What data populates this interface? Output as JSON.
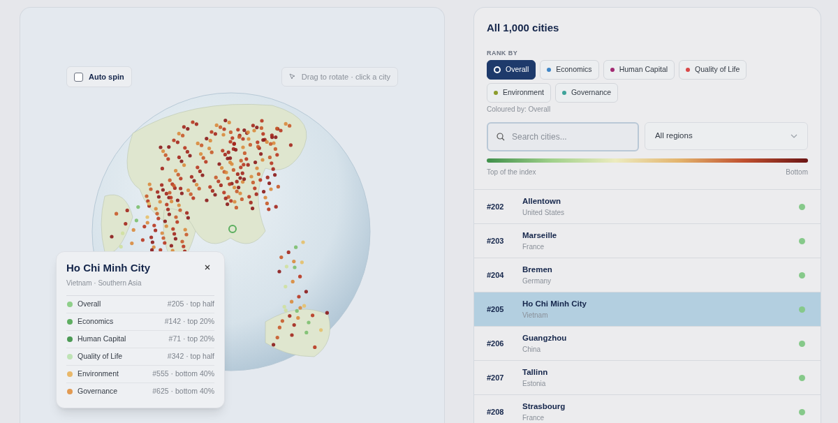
{
  "globe_view": {
    "auto_spin": {
      "label": "Auto spin",
      "checked": false
    },
    "hint": "Drag to rotate · click a city"
  },
  "city_card": {
    "title": "Ho Chi Minh City",
    "subtitle": "Vietnam · Southern Asia",
    "metrics": [
      {
        "label": "Overall",
        "value": "#205 · top half",
        "color": "#8fcf8a"
      },
      {
        "label": "Economics",
        "value": "#142 · top 20%",
        "color": "#5fae62"
      },
      {
        "label": "Human Capital",
        "value": "#71 · top 20%",
        "color": "#4c9a55"
      },
      {
        "label": "Quality of Life",
        "value": "#342 · top half",
        "color": "#bfe3b5"
      },
      {
        "label": "Environment",
        "value": "#555 · bottom 40%",
        "color": "#e9b86a"
      },
      {
        "label": "Governance",
        "value": "#625 · bottom 40%",
        "color": "#e29a52"
      }
    ]
  },
  "city_list": {
    "title": "All 1,000 cities",
    "rank_by_label": "RANK BY",
    "rank_options": [
      {
        "label": "Overall",
        "color": "#ffffff",
        "selected": true
      },
      {
        "label": "Economics",
        "color": "#3f86c6",
        "selected": false
      },
      {
        "label": "Human Capital",
        "color": "#a22a72",
        "selected": false
      },
      {
        "label": "Quality of Life",
        "color": "#d94848",
        "selected": false
      },
      {
        "label": "Environment",
        "color": "#8c9c2c",
        "selected": false
      },
      {
        "label": "Governance",
        "color": "#3fa39a",
        "selected": false
      }
    ],
    "coloured_by": "Coloured by: Overall",
    "search": {
      "placeholder": "Search cities..."
    },
    "region_select": {
      "value": "All regions"
    },
    "legend": {
      "start": "Top of the index",
      "end": "Bottom"
    },
    "cities": [
      {
        "rank": "#202",
        "name": "Allentown",
        "country": "United States",
        "color": "#86c98a",
        "selected": false
      },
      {
        "rank": "#203",
        "name": "Marseille",
        "country": "France",
        "color": "#86c98a",
        "selected": false
      },
      {
        "rank": "#204",
        "name": "Bremen",
        "country": "Germany",
        "color": "#86c98a",
        "selected": false
      },
      {
        "rank": "#205",
        "name": "Ho Chi Minh City",
        "country": "Vietnam",
        "color": "#86c98a",
        "selected": true
      },
      {
        "rank": "#206",
        "name": "Guangzhou",
        "country": "China",
        "color": "#86c98a",
        "selected": false
      },
      {
        "rank": "#207",
        "name": "Tallinn",
        "country": "Estonia",
        "color": "#86c98a",
        "selected": false
      },
      {
        "rank": "#208",
        "name": "Strasbourg",
        "country": "France",
        "color": "#86c98a",
        "selected": false
      }
    ]
  }
}
